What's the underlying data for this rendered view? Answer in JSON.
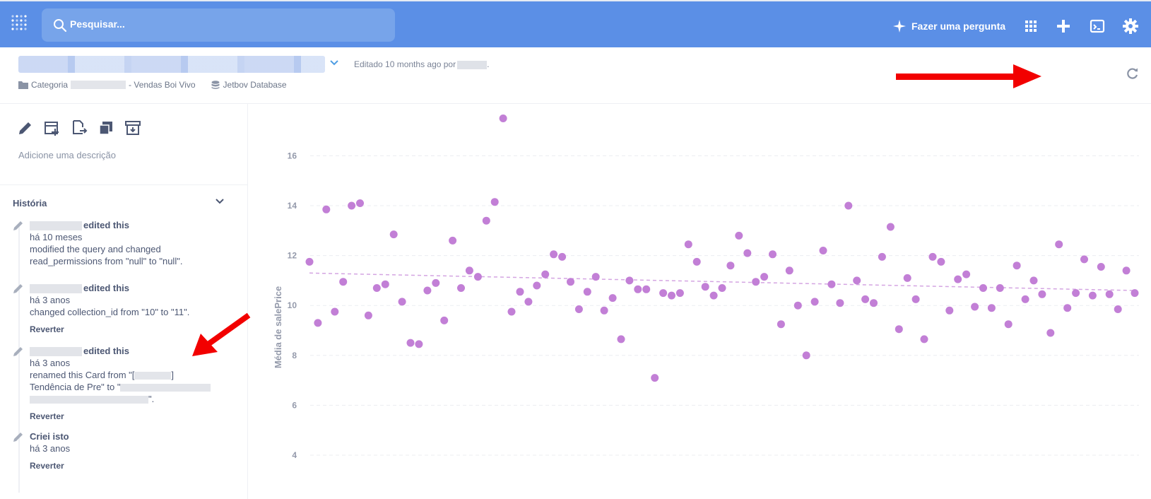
{
  "nav": {
    "search_placeholder": "Pesquisar...",
    "ask_label": "Fazer uma pergunta",
    "icons": [
      "logo-icon",
      "search-icon",
      "sparkle-icon",
      "apps-grid-icon",
      "plus-icon",
      "terminal-icon",
      "gear-icon"
    ],
    "colors": {
      "bar": "#5b8fe6",
      "search": "#77a4ea"
    }
  },
  "header": {
    "edited_label": "Editado 10 months ago por",
    "edited_suffix": ".",
    "breadcrumb_category_prefix": "Categoria",
    "breadcrumb_category_suffix": "- Vendas Boi Vivo",
    "breadcrumb_database": "Jetbov Database"
  },
  "sidebar": {
    "description_placeholder": "Adicione uma descrição",
    "history_title": "História",
    "events": [
      {
        "who": "edited this",
        "when": "há 10 meses",
        "lines": [
          "modified the query and changed",
          "read_permissions from \"null\" to \"null\"."
        ],
        "revert": ""
      },
      {
        "who": "edited this",
        "when": "há 3 anos",
        "lines": [
          "changed collection_id from \"10\" to \"11\"."
        ],
        "revert": "Reverter"
      },
      {
        "who": "edited this",
        "when": "há 3 anos",
        "line1": "renamed this Card from \"[",
        "line2": "Tendência de Pre\" to \"",
        "line3": "\".",
        "revert": "Reverter"
      },
      {
        "who": "Criei isto",
        "when": "há 3 anos",
        "lines": [],
        "revert": "Reverter"
      }
    ]
  },
  "chart_data": {
    "type": "scatter",
    "ylabel": "Média de salePrice",
    "y_ticks": [
      "4",
      "6",
      "8",
      "10",
      "12",
      "14",
      "16"
    ],
    "ylim": [
      4,
      17.5
    ],
    "grid": true,
    "point_color": "#c27fd6",
    "trend": {
      "start": 11.3,
      "end": 10.6
    },
    "points": [
      11.75,
      9.3,
      13.85,
      9.75,
      10.95,
      14.0,
      14.1,
      9.6,
      10.7,
      10.85,
      12.85,
      10.15,
      8.5,
      8.45,
      10.6,
      10.9,
      9.4,
      12.6,
      10.7,
      11.4,
      11.15,
      13.4,
      14.15,
      17.5,
      9.75,
      10.55,
      10.15,
      10.8,
      11.25,
      12.05,
      11.95,
      10.95,
      9.85,
      10.55,
      11.15,
      9.8,
      10.3,
      8.65,
      11.0,
      10.65,
      10.65,
      7.1,
      10.5,
      10.4,
      10.5,
      12.45,
      11.75,
      10.75,
      10.4,
      10.7,
      11.6,
      12.8,
      12.1,
      10.95,
      11.15,
      12.05,
      9.25,
      11.4,
      10.0,
      8.0,
      10.15,
      12.2,
      10.85,
      10.1,
      14.0,
      11.0,
      10.25,
      10.1,
      11.95,
      13.15,
      9.05,
      11.1,
      10.25,
      8.65,
      11.95,
      11.75,
      9.8,
      11.05,
      11.25,
      9.95,
      10.7,
      9.9,
      10.7,
      9.25,
      11.6,
      10.25,
      11.0,
      10.45,
      8.9,
      12.45,
      9.9,
      10.5,
      11.85,
      10.4,
      11.55,
      10.45,
      9.85,
      11.4,
      10.5
    ]
  }
}
